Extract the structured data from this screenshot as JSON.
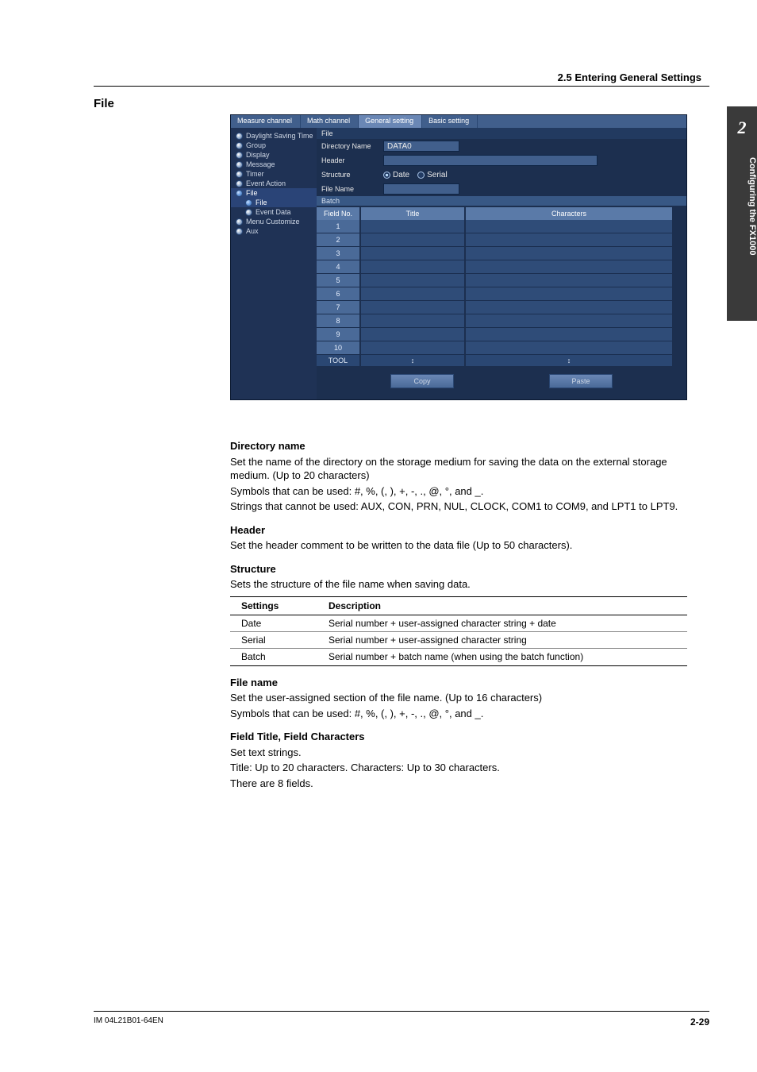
{
  "header": {
    "section": "2.5  Entering General Settings"
  },
  "side_tab": {
    "chapter": "2",
    "label": "Configuring the FX1000"
  },
  "left_title": "File",
  "app": {
    "tabs": [
      "Measure channel",
      "Math channel",
      "General setting",
      "Basic setting"
    ],
    "active_tab_index": 2,
    "side_items": [
      {
        "label": "Daylight Saving Time"
      },
      {
        "label": "Group"
      },
      {
        "label": "Display"
      },
      {
        "label": "Message"
      },
      {
        "label": "Timer"
      },
      {
        "label": "Event Action"
      },
      {
        "label": "File",
        "selected": true
      },
      {
        "label": "File",
        "sub": true,
        "selected": true
      },
      {
        "label": "Event Data",
        "sub": true
      },
      {
        "label": "Menu Customize"
      },
      {
        "label": "Aux"
      }
    ],
    "form": {
      "title": "File",
      "directory_label": "Directory Name",
      "directory_value": "DATA0",
      "header_label": "Header",
      "header_value": "",
      "structure_label": "Structure",
      "structure_options": [
        "Date",
        "Serial"
      ],
      "filename_label": "File Name",
      "filename_value": "",
      "batch_bar": "Batch"
    },
    "grid": {
      "headers": [
        "Field No.",
        "Title",
        "Characters"
      ],
      "rows": [
        "1",
        "2",
        "3",
        "4",
        "5",
        "6",
        "7",
        "8",
        "9",
        "10"
      ],
      "tool_label": "TOOL"
    },
    "buttons": {
      "copy": "Copy",
      "paste": "Paste"
    }
  },
  "doc": {
    "dir_h": "Directory name",
    "dir_p1": "Set the name of the directory on the storage medium for saving the data on the external storage medium. (Up to 20 characters)",
    "dir_p2": "Symbols that can be used: #, %, (, ), +, -, ., @, °, and _.",
    "dir_p3": "Strings that cannot be used: AUX, CON, PRN, NUL, CLOCK, COM1 to COM9, and LPT1 to LPT9.",
    "hdr_h": "Header",
    "hdr_p": "Set the header comment to be written to the data file (Up to 50 characters).",
    "str_h": "Structure",
    "str_p": "Sets the structure of the file name when saving data.",
    "str_table": {
      "h1": "Settings",
      "h2": "Description",
      "r1a": "Date",
      "r1b": "Serial number + user-assigned character string + date",
      "r2a": "Serial",
      "r2b": "Serial number + user-assigned character string",
      "r3a": "Batch",
      "r3b": "Serial number + batch name (when using the batch function)"
    },
    "fn_h": "File name",
    "fn_p1": "Set the user-assigned section of the file name.  (Up to 16 characters)",
    "fn_p2": "Symbols that can be used: #, %, (, ), +, -, ., @, °, and _.",
    "ft_h": "Field Title, Field Characters",
    "ft_p1": "Set text strings.",
    "ft_p2": "Title: Up to 20 characters. Characters: Up to 30 characters.",
    "ft_p3": "There are 8 fields."
  },
  "footer": {
    "doc_id": "IM 04L21B01-64EN",
    "page": "2-29"
  }
}
